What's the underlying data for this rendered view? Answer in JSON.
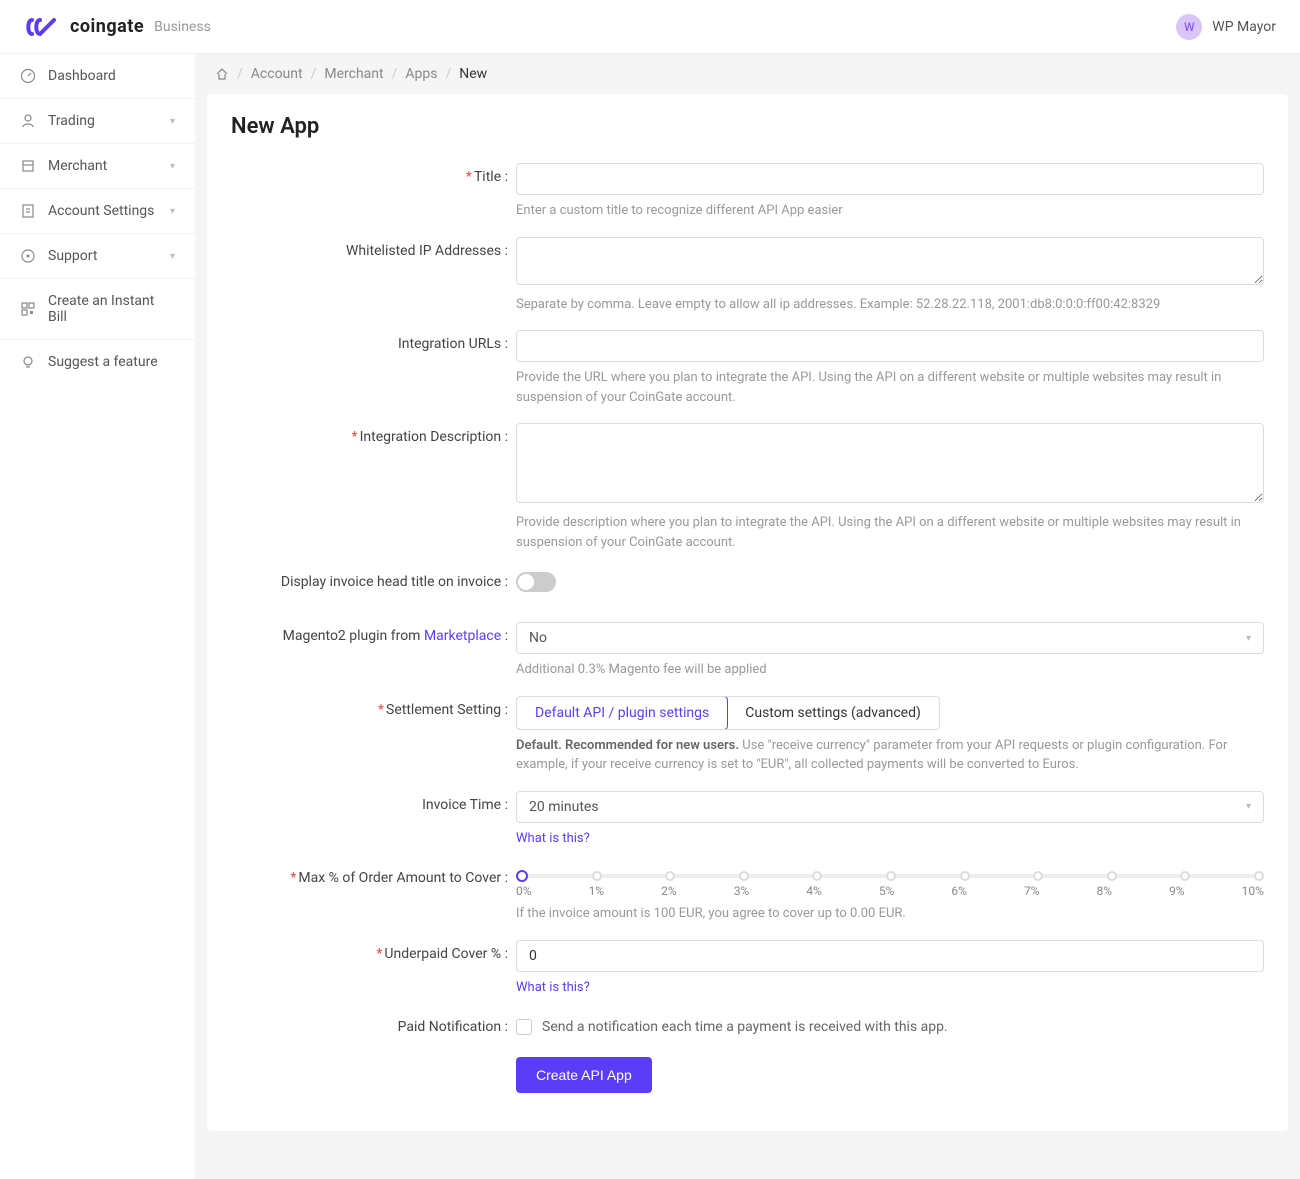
{
  "header": {
    "brand_name": "coingate",
    "brand_sub": "Business",
    "avatar_letter": "W",
    "user_name": "WP Mayor"
  },
  "sidebar": {
    "items": [
      {
        "label": "Dashboard",
        "expandable": false
      },
      {
        "label": "Trading",
        "expandable": true
      },
      {
        "label": "Merchant",
        "expandable": true
      },
      {
        "label": "Account Settings",
        "expandable": true
      },
      {
        "label": "Support",
        "expandable": true
      },
      {
        "label": "Create an Instant Bill",
        "expandable": false
      },
      {
        "label": "Suggest a feature",
        "expandable": false
      }
    ]
  },
  "breadcrumb": {
    "items": [
      "Account",
      "Merchant",
      "Apps"
    ],
    "current": "New"
  },
  "page": {
    "title": "New App"
  },
  "form": {
    "title": {
      "label": "Title",
      "hint": "Enter a custom title to recognize different API App easier"
    },
    "whitelist": {
      "label": "Whitelisted IP Addresses",
      "hint": "Separate by comma. Leave empty to allow all ip addresses. Example: 52.28.22.118, 2001:db8:0:0:0:ff00:42:8329"
    },
    "integration_urls": {
      "label": "Integration URLs",
      "hint": "Provide the URL where you plan to integrate the API. Using the API on a different website or multiple websites may result in suspension of your CoinGate account."
    },
    "integration_desc": {
      "label": "Integration Description",
      "hint": "Provide description where you plan to integrate the API. Using the API on a different website or multiple websites may result in suspension of your CoinGate account."
    },
    "display_invoice": {
      "label": "Display invoice head title on invoice"
    },
    "magento": {
      "label_pre": "Magento2 plugin from ",
      "label_link": "Marketplace",
      "value": "No",
      "hint": "Additional 0.3% Magento fee will be applied"
    },
    "settlement": {
      "label": "Settlement Setting",
      "option1": "Default API / plugin settings",
      "option2": "Custom settings (advanced)",
      "hint_bold": "Default. Recommended for new users.",
      "hint_rest": " Use \"receive currency\" parameter from your API requests or plugin configuration. For example, if your receive currency is set to \"EUR\", all collected payments will be converted to Euros."
    },
    "invoice_time": {
      "label": "Invoice Time",
      "value": "20 minutes",
      "hint_link": "What is this?"
    },
    "max_pct": {
      "label": "Max % of Order Amount to Cover",
      "marks": [
        "0%",
        "1%",
        "2%",
        "3%",
        "4%",
        "5%",
        "6%",
        "7%",
        "8%",
        "9%",
        "10%"
      ],
      "hint": "If the invoice amount is 100 EUR, you agree to cover up to 0.00 EUR."
    },
    "underpaid": {
      "label": "Underpaid Cover %",
      "value": "0",
      "hint_link": "What is this?"
    },
    "paid_notif": {
      "label": "Paid Notification",
      "text": "Send a notification each time a payment is received with this app."
    },
    "submit": "Create API App"
  }
}
